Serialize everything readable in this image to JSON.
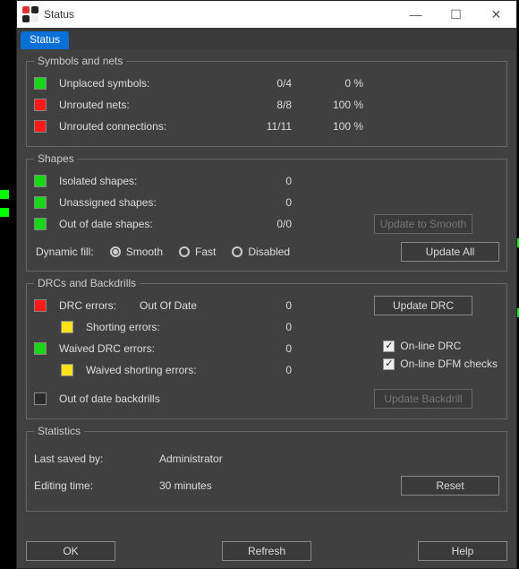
{
  "window": {
    "title": "Status"
  },
  "tab": {
    "label": "Status"
  },
  "symbols": {
    "legend": "Symbols and nets",
    "rows": [
      {
        "color": "green",
        "label": "Unplaced symbols:",
        "val": "0/4",
        "pct": "0 %"
      },
      {
        "color": "red",
        "label": "Unrouted nets:",
        "val": "8/8",
        "pct": "100 %"
      },
      {
        "color": "red",
        "label": "Unrouted connections:",
        "val": "11/11",
        "pct": "100 %"
      }
    ]
  },
  "shapes": {
    "legend": "Shapes",
    "rows": [
      {
        "color": "green",
        "label": "Isolated shapes:",
        "val": "0"
      },
      {
        "color": "green",
        "label": "Unassigned shapes:",
        "val": "0"
      },
      {
        "color": "green",
        "label": "Out of date shapes:",
        "val": "0/0"
      }
    ],
    "update_smooth": "Update to Smooth",
    "dynfill_label": "Dynamic fill:",
    "opts": {
      "smooth": "Smooth",
      "fast": "Fast",
      "disabled": "Disabled"
    },
    "update_all": "Update All"
  },
  "drc": {
    "legend": "DRCs and Backdrills",
    "row1": {
      "color": "red",
      "label": "DRC errors:",
      "status": "Out Of Date",
      "val": "0"
    },
    "update_drc": "Update DRC",
    "row2": {
      "color": "yellow",
      "label": "Shorting errors:",
      "val": "0"
    },
    "row3": {
      "color": "green",
      "label": "Waived DRC errors:",
      "val": "0"
    },
    "row4": {
      "color": "yellow",
      "label": "Waived shorting errors:",
      "val": "0"
    },
    "checks": {
      "online_drc": "On-line DRC",
      "online_dfm": "On-line DFM checks"
    },
    "row5": {
      "color": "dark",
      "label": "Out of date backdrills"
    },
    "update_backdrill": "Update Backdrill"
  },
  "stats": {
    "legend": "Statistics",
    "saved_label": "Last saved by:",
    "saved_val": "Administrator",
    "time_label": "Editing time:",
    "time_val": "30 minutes",
    "reset": "Reset"
  },
  "buttons": {
    "ok": "OK",
    "refresh": "Refresh",
    "help": "Help"
  }
}
